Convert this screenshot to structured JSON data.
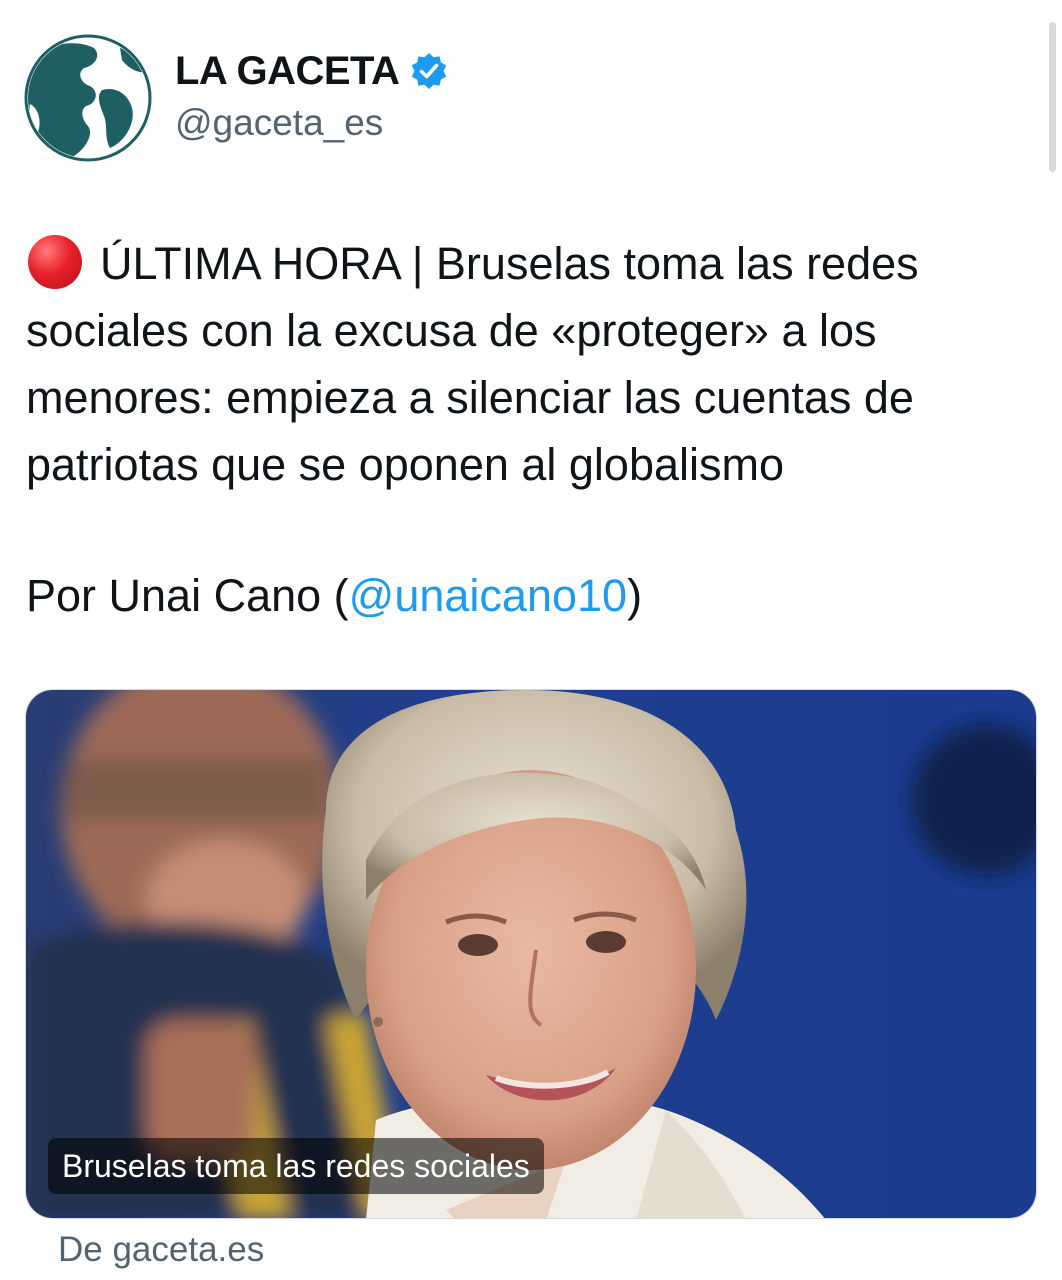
{
  "author": {
    "display_name": "LA GACETA",
    "handle": "@gaceta_es",
    "verified": true,
    "avatar_icon": "globe-logo-icon",
    "verified_color": "#1d9bf0"
  },
  "tweet": {
    "status_icon": "red-circle-icon",
    "text": "ÚLTIMA HORA | Bruselas toma las redes sociales con la excusa de «proteger» a los menores: empieza a silenciar las cuentas de patriotas que se oponen al globalismo",
    "byline_prefix": "Por Unai Cano (",
    "byline_mention": "@unaicano10",
    "byline_suffix": ")",
    "mention_color": "#1d9bf0"
  },
  "link_card": {
    "title": "Bruselas toma las redes sociales",
    "source": "De gaceta.es"
  }
}
